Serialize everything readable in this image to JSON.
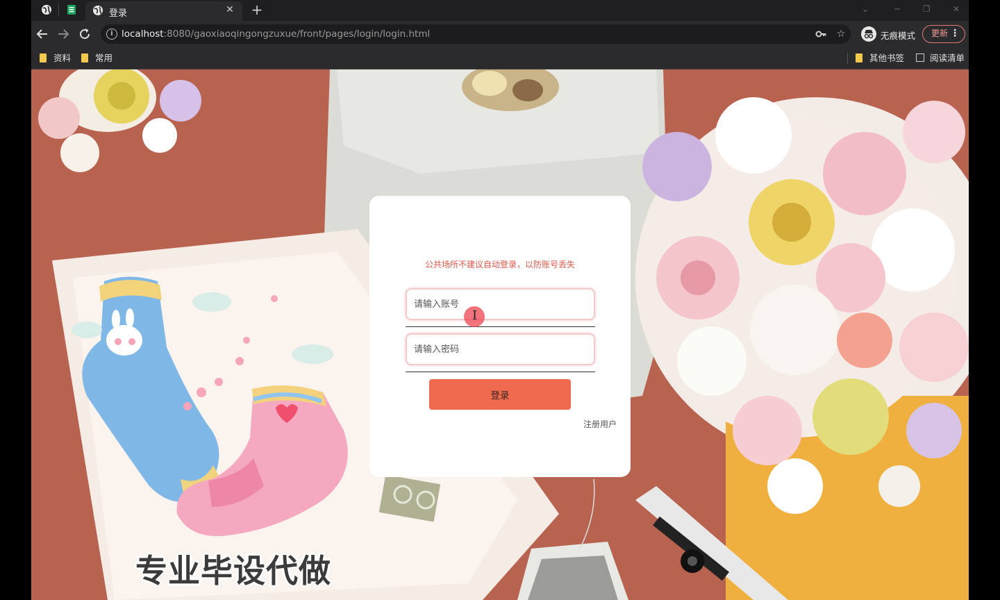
{
  "browser": {
    "tab": {
      "title": "登录"
    },
    "url": {
      "host": "localhost",
      "path": ":8080/gaoxiaoqingongzuxue/front/pages/login/login.html"
    },
    "incognito_label": "无痕模式",
    "update_label": "更新",
    "bookmarks": {
      "left": [
        "资料",
        "常用"
      ],
      "other": "其他书签",
      "reading_list": "阅读清单"
    }
  },
  "login": {
    "hint": "公共场所不建议自动登录，以防账号丢失",
    "account_placeholder": "请输入账号",
    "password_placeholder": "请输入密码",
    "login_button": "登录",
    "register_link": "注册用户"
  },
  "watermark": "专业毕设代做",
  "colors": {
    "background_red": "#b86350",
    "login_button": "#ef6a4e",
    "hint_text": "#e0574a",
    "update_button_border": "#e07a74"
  },
  "icons": {
    "tab_icons": [
      "globe-icon",
      "spreadsheet-icon"
    ],
    "nav": [
      "back-arrow-icon",
      "forward-arrow-icon",
      "reload-icon"
    ],
    "omnibox": [
      "info-icon",
      "key-icon",
      "star-icon"
    ]
  }
}
